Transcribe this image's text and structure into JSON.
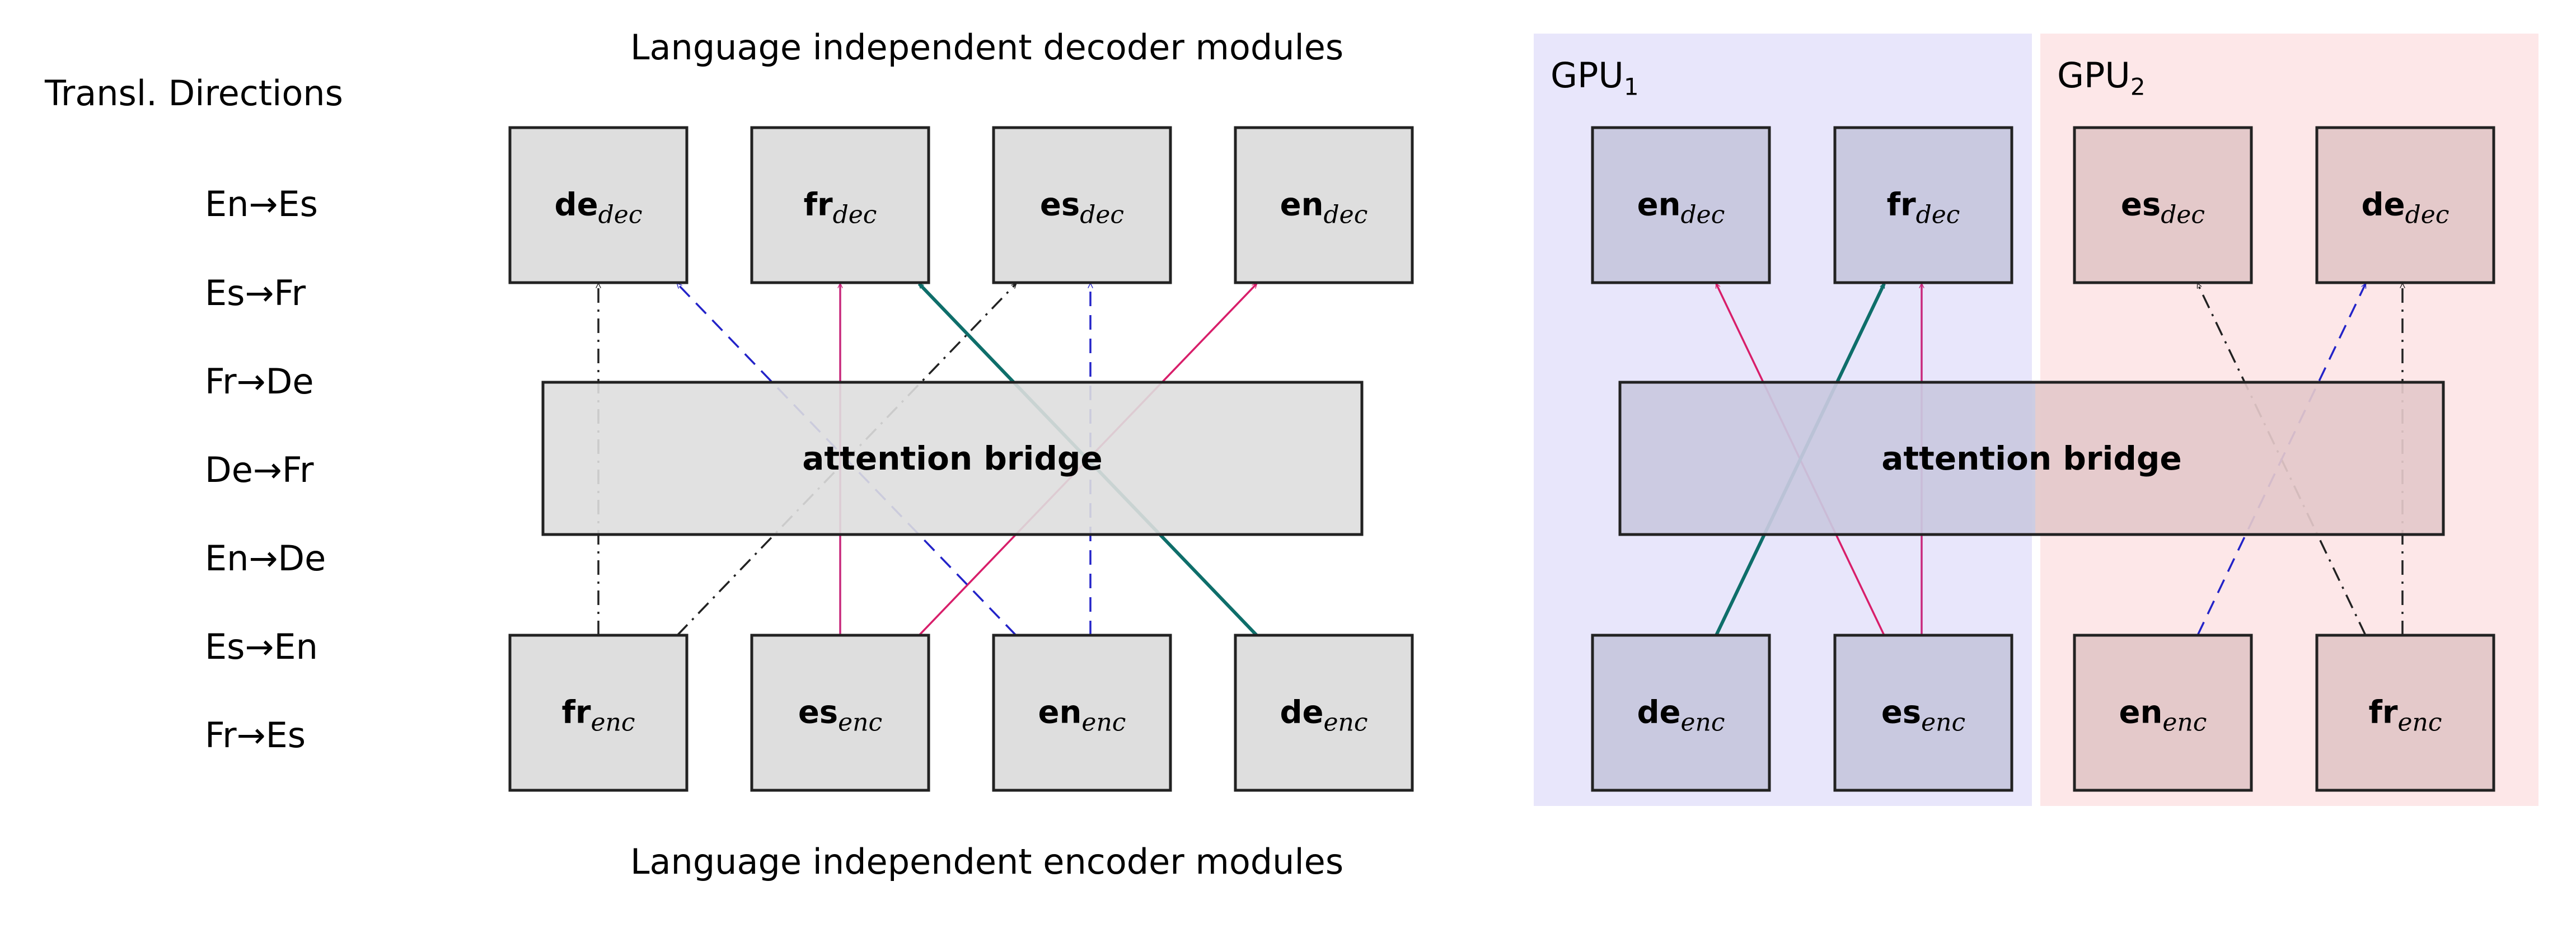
{
  "left_panel": {
    "directions_title": "Transl.  Directions",
    "directions": [
      "En→Es",
      "Es→Fr",
      "Fr→De",
      "De→Fr",
      "En→De",
      "Es→En",
      "Fr→Es"
    ],
    "decoder_caption": "Language independent decoder modules",
    "encoder_caption": "Language independent encoder modules",
    "decoders": [
      {
        "id": "de_dec",
        "lang": "de",
        "sub": "dec"
      },
      {
        "id": "fr_dec",
        "lang": "fr",
        "sub": "dec"
      },
      {
        "id": "es_dec",
        "lang": "es",
        "sub": "dec"
      },
      {
        "id": "en_dec",
        "lang": "en",
        "sub": "dec"
      }
    ],
    "encoders": [
      {
        "id": "fr_enc",
        "lang": "fr",
        "sub": "enc"
      },
      {
        "id": "es_enc",
        "lang": "es",
        "sub": "enc"
      },
      {
        "id": "en_enc",
        "lang": "en",
        "sub": "enc"
      },
      {
        "id": "de_enc",
        "lang": "de",
        "sub": "enc"
      }
    ],
    "bridge_label": "attention bridge",
    "edges": [
      {
        "from": "fr_enc",
        "to": "de_dec",
        "style": "dashdot",
        "color": "#222222"
      },
      {
        "from": "fr_enc",
        "to": "es_dec",
        "style": "dashdot",
        "color": "#222222"
      },
      {
        "from": "es_enc",
        "to": "fr_dec",
        "style": "solid",
        "color": "#c8287c"
      },
      {
        "from": "es_enc",
        "to": "en_dec",
        "style": "solid",
        "color": "#d81e6a"
      },
      {
        "from": "en_enc",
        "to": "de_dec",
        "style": "dashed",
        "color": "#2323c8"
      },
      {
        "from": "en_enc",
        "to": "es_dec",
        "style": "dashed",
        "color": "#2323c8"
      },
      {
        "from": "de_enc",
        "to": "fr_dec",
        "style": "thick",
        "color": "#0e6e6a"
      }
    ]
  },
  "right_panel": {
    "gpus": [
      {
        "name": "GPU",
        "index": "1",
        "fill": "#e8e6fb",
        "box_fill": "#c9c9e0",
        "decoders": [
          {
            "id": "en_dec",
            "lang": "en",
            "sub": "dec"
          },
          {
            "id": "fr_dec",
            "lang": "fr",
            "sub": "dec"
          }
        ],
        "encoders": [
          {
            "id": "de_enc",
            "lang": "de",
            "sub": "enc"
          },
          {
            "id": "es_enc",
            "lang": "es",
            "sub": "enc"
          }
        ]
      },
      {
        "name": "GPU",
        "index": "2",
        "fill": "#fde7e8",
        "box_fill": "#e4c9ca",
        "decoders": [
          {
            "id": "es_dec",
            "lang": "es",
            "sub": "dec"
          },
          {
            "id": "de_dec",
            "lang": "de",
            "sub": "dec"
          }
        ],
        "encoders": [
          {
            "id": "en_enc",
            "lang": "en",
            "sub": "enc"
          },
          {
            "id": "fr_enc",
            "lang": "fr",
            "sub": "enc"
          }
        ]
      }
    ],
    "bridge_label": "attention bridge",
    "edges": [
      {
        "from": "es_enc",
        "to": "en_dec",
        "style": "solid",
        "color": "#d81e6a"
      },
      {
        "from": "de_enc",
        "to": "fr_dec",
        "style": "thick",
        "color": "#0e6e6a"
      },
      {
        "from": "es_enc",
        "to": "fr_dec",
        "style": "solid",
        "color": "#c8287c"
      },
      {
        "from": "fr_enc",
        "to": "es_dec",
        "style": "dashdot",
        "color": "#222222"
      },
      {
        "from": "en_enc",
        "to": "de_dec",
        "style": "dashed",
        "color": "#2323c8"
      },
      {
        "from": "fr_enc",
        "to": "de_dec",
        "style": "dashdot",
        "color": "#222222"
      }
    ]
  },
  "colors": {
    "module_fill": "#dedede",
    "module_stroke": "#222222",
    "bridge_fill_left": "#dedede"
  }
}
